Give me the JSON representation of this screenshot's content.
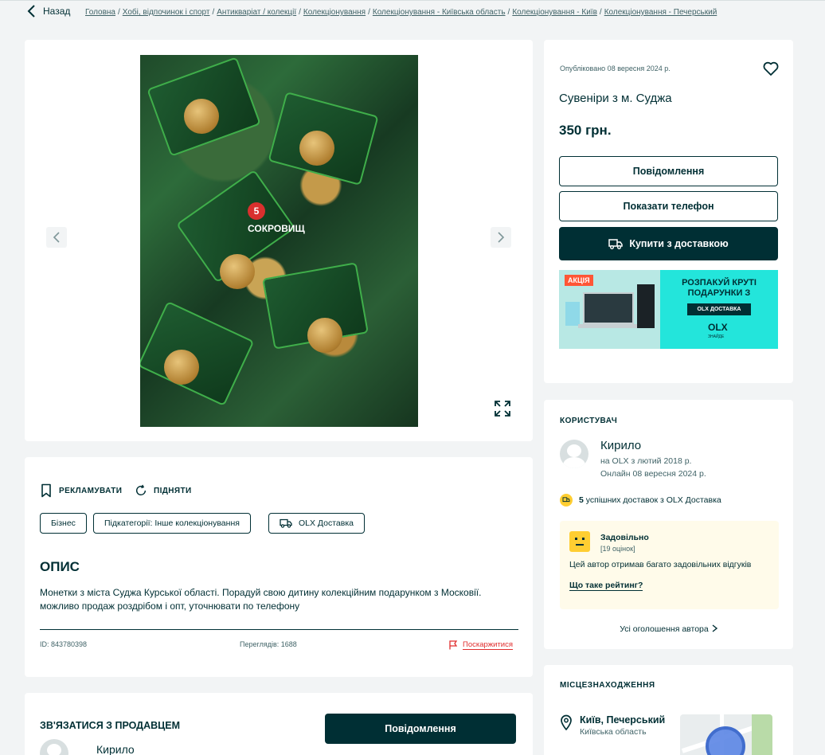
{
  "nav": {
    "back_label": "Назад",
    "breadcrumbs": [
      "Головна",
      "Хобі, відпочинок і спорт",
      "Антикваріат / колекції",
      "Колекціонування",
      "Колекціонування - Київська область",
      "Колекціонування - Київ",
      "Колекціонування - Печерський"
    ]
  },
  "gallery": {
    "prev_icon": "chevron-left-icon",
    "next_icon": "chevron-right-icon",
    "expand_icon": "fullscreen-icon",
    "photo_text": "5 СОКРОВИЩ"
  },
  "listing": {
    "published": "Опубліковано 08 вересня 2024 р.",
    "title": "Сувеніри з м. Суджа",
    "price": "350 грн.",
    "message_button": "Повідомлення",
    "show_phone_button": "Показати телефон",
    "buy_button": "Купити з доставкою"
  },
  "promo": {
    "tag": "АКЦІЯ",
    "headline_1": "РОЗПАКУЙ КРУТІ",
    "headline_2": "ПОДАРУНКИ З",
    "delivery": "OLX ДОСТАВКА",
    "logo": "OLX",
    "slogan": "ЗНАЙДЕ"
  },
  "user": {
    "section_title": "КОРИСТУВАЧ",
    "name": "Кирило",
    "since": "на OLX з лютий 2018 р.",
    "online": "Онлайн 08 вересня 2024 р.",
    "deliveries_count": "5",
    "deliveries_text": "успішних доставок з OLX Доставка",
    "rating_title": "Задовільно",
    "rating_count": "[19 оцінок]",
    "rating_desc": "Цей автор отримав багато задовільних відгуків",
    "rating_link": "Що таке рейтинг?",
    "all_ads": "Усі оголошення автора"
  },
  "location": {
    "section_title": "МІСЦЕЗНАХОДЖЕННЯ",
    "city": "Київ, Печерський",
    "region": "Київська область"
  },
  "description": {
    "promote": "РЕКЛАМУВАТИ",
    "raise": "ПІДНЯТИ",
    "tags": [
      "Бізнес",
      "Підкатегорії: Інше колекціонування",
      "OLX Доставка"
    ],
    "heading": "ОПИС",
    "text": "Монетки з міста Суджа Курської області. Порадуй свою дитину колекційним подарунком з Московії. можливо продаж роздрібом і опт, уточнювати по телефону",
    "id": "ID: 843780398",
    "views": "Переглядів: 1688",
    "report": "Поскаржитися"
  },
  "contact": {
    "heading": "ЗВ'ЯЗАТИСЯ З ПРОДАВЦЕМ",
    "button": "Повідомлення",
    "name": "Кирило"
  }
}
